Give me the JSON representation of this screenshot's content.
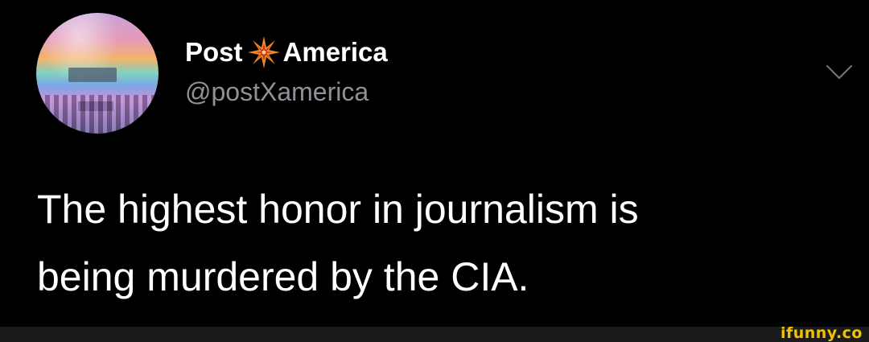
{
  "tweet": {
    "display_name_part1": "Post",
    "display_name_part2": "America",
    "name_separator_icon": "spark-star-icon",
    "handle": "@postXamerica",
    "text_line1": "The highest honor in journalism is",
    "text_line2": "being murdered by the CIA.",
    "menu_icon": "chevron-down-icon"
  },
  "watermark": {
    "text": "ifunny.co"
  },
  "colors": {
    "background": "#000000",
    "text": "#ffffff",
    "handle": "#8e9296",
    "star_orange": "#f08a24",
    "star_red": "#c8351e",
    "footer": "#1b1b1b",
    "watermark": "#f2c200"
  }
}
